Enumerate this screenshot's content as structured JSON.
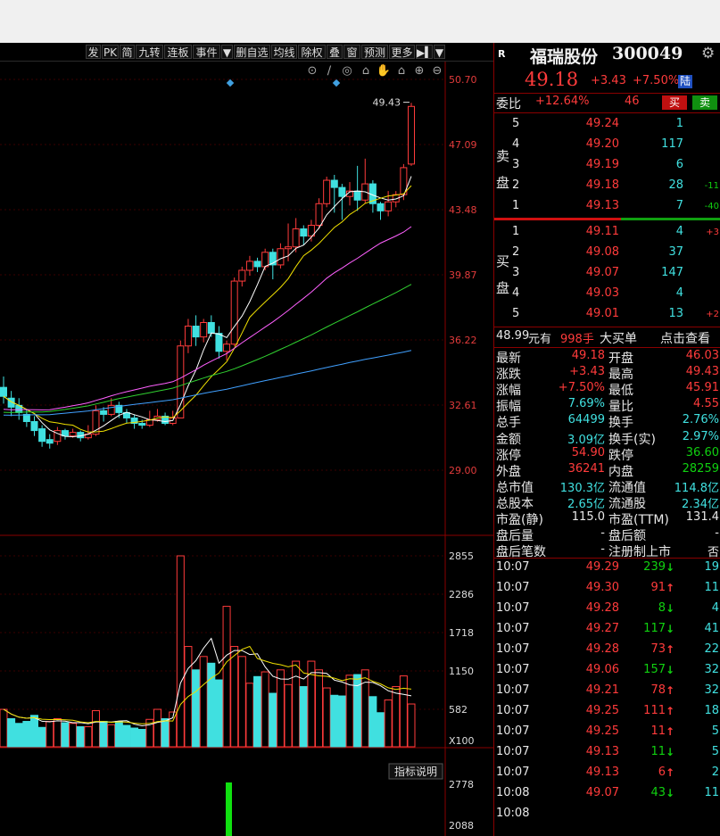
{
  "toolbar": {
    "items": [
      "发",
      "PK",
      "简",
      "九转",
      "连板",
      "事件",
      "▼",
      "删自选",
      "均线",
      "除权",
      "叠",
      "窗",
      "预测",
      "更多",
      "▶▍",
      "▼"
    ]
  },
  "kline": {
    "price_axis": [
      "50.70",
      "47.09",
      "43.48",
      "39.87",
      "36.22",
      "32.61",
      "29.00"
    ],
    "high_marker": "49.43"
  },
  "volume": {
    "axis": [
      "2855",
      "2286",
      "1718",
      "1150",
      "582",
      "X100"
    ]
  },
  "indicator": {
    "button_label": "指标说明",
    "axis": [
      "2778",
      "2088"
    ]
  },
  "stock": {
    "badge": "R",
    "name": "福瑞股份",
    "code": "300049",
    "price": "49.18",
    "change": "+3.43",
    "change_pct": "+7.50%",
    "market_tag": "陆"
  },
  "weibi": {
    "label": "委比",
    "ratio": "+12.64%",
    "diff": "46",
    "buy_btn": "买",
    "sell_btn": "卖"
  },
  "sell_side_label": [
    "卖",
    "盘"
  ],
  "buy_side_label": [
    "买",
    "盘"
  ],
  "asks": [
    {
      "level": "5",
      "price": "49.24",
      "vol": "1",
      "chg": ""
    },
    {
      "level": "4",
      "price": "49.20",
      "vol": "117",
      "chg": ""
    },
    {
      "level": "3",
      "price": "49.19",
      "vol": "6",
      "chg": ""
    },
    {
      "level": "2",
      "price": "49.18",
      "vol": "28",
      "chg": "-11"
    },
    {
      "level": "1",
      "price": "49.13",
      "vol": "7",
      "chg": "-40"
    }
  ],
  "bids": [
    {
      "level": "1",
      "price": "49.11",
      "vol": "4",
      "chg": "+3"
    },
    {
      "level": "2",
      "price": "49.08",
      "vol": "37",
      "chg": ""
    },
    {
      "level": "3",
      "price": "49.07",
      "vol": "147",
      "chg": ""
    },
    {
      "level": "4",
      "price": "49.03",
      "vol": "4",
      "chg": ""
    },
    {
      "level": "5",
      "price": "49.01",
      "vol": "13",
      "chg": "+2"
    }
  ],
  "big_order": {
    "price": "48.99",
    "unit": "元有",
    "qty": "998手",
    "text": "大买单",
    "link": "点击查看"
  },
  "stats": [
    {
      "l1": "最新",
      "v1": "49.18",
      "c1": "red",
      "l2": "开盘",
      "v2": "46.03",
      "c2": "red"
    },
    {
      "l1": "涨跌",
      "v1": "+3.43",
      "c1": "red",
      "l2": "最高",
      "v2": "49.43",
      "c2": "red"
    },
    {
      "l1": "涨幅",
      "v1": "+7.50%",
      "c1": "red",
      "l2": "最低",
      "v2": "45.91",
      "c2": "red"
    },
    {
      "l1": "振幅",
      "v1": "7.69%",
      "c1": "cyan",
      "l2": "量比",
      "v2": "4.55",
      "c2": "red"
    },
    {
      "l1": "总手",
      "v1": "64499",
      "c1": "cyan",
      "l2": "换手",
      "v2": "2.76%",
      "c2": "cyan"
    },
    {
      "l1": "金额",
      "v1": "3.09亿",
      "c1": "cyan",
      "l2": "换手(实)",
      "v2": "2.97%",
      "c2": "cyan"
    },
    {
      "l1": "涨停",
      "v1": "54.90",
      "c1": "red",
      "l2": "跌停",
      "v2": "36.60",
      "c2": "green"
    },
    {
      "l1": "外盘",
      "v1": "36241",
      "c1": "red",
      "l2": "内盘",
      "v2": "28259",
      "c2": "green"
    },
    {
      "l1": "总市值",
      "v1": "130.3亿",
      "c1": "cyan",
      "l2": "流通值",
      "v2": "114.8亿",
      "c2": "cyan"
    },
    {
      "l1": "总股本",
      "v1": "2.65亿",
      "c1": "cyan",
      "l2": "流通股",
      "v2": "2.34亿",
      "c2": "cyan"
    },
    {
      "l1": "市盈(静)",
      "v1": "115.0",
      "c1": "white",
      "l2": "市盈(TTM)",
      "v2": "131.4",
      "c2": "white"
    },
    {
      "l1": "盘后量",
      "v1": "-",
      "c1": "white",
      "l2": "盘后额",
      "v2": "-",
      "c2": "white"
    },
    {
      "l1": "盘后笔数",
      "v1": "-",
      "c1": "white",
      "l2": "注册制上市",
      "v2": "否",
      "c2": "white"
    }
  ],
  "ticks": [
    {
      "time": "10:07",
      "price": "49.29",
      "vol": "239",
      "dir": "down",
      "n": "19"
    },
    {
      "time": "10:07",
      "price": "49.30",
      "vol": "91",
      "dir": "up",
      "n": "11"
    },
    {
      "time": "10:07",
      "price": "49.28",
      "vol": "8",
      "dir": "down",
      "n": "4"
    },
    {
      "time": "10:07",
      "price": "49.27",
      "vol": "117",
      "dir": "down",
      "n": "41"
    },
    {
      "time": "10:07",
      "price": "49.28",
      "vol": "73",
      "dir": "up",
      "n": "22"
    },
    {
      "time": "10:07",
      "price": "49.06",
      "vol": "157",
      "dir": "down",
      "n": "32"
    },
    {
      "time": "10:07",
      "price": "49.21",
      "vol": "78",
      "dir": "up",
      "n": "32"
    },
    {
      "time": "10:07",
      "price": "49.25",
      "vol": "111",
      "dir": "up",
      "n": "18"
    },
    {
      "time": "10:07",
      "price": "49.25",
      "vol": "11",
      "dir": "up",
      "n": "5"
    },
    {
      "time": "10:07",
      "price": "49.13",
      "vol": "11",
      "dir": "down",
      "n": "5"
    },
    {
      "time": "10:07",
      "price": "49.13",
      "vol": "6",
      "dir": "up",
      "n": "2"
    },
    {
      "time": "10:08",
      "price": "49.07",
      "vol": "43",
      "dir": "down",
      "n": "11"
    },
    {
      "time": "10:08",
      "price": "",
      "vol": "",
      "dir": "",
      "n": ""
    }
  ],
  "colors": {
    "up": "#ff3b3b",
    "down": "#10d010",
    "cyan": "#40e0e0",
    "yellow": "#f0e000",
    "frame": "#8a0000"
  }
}
